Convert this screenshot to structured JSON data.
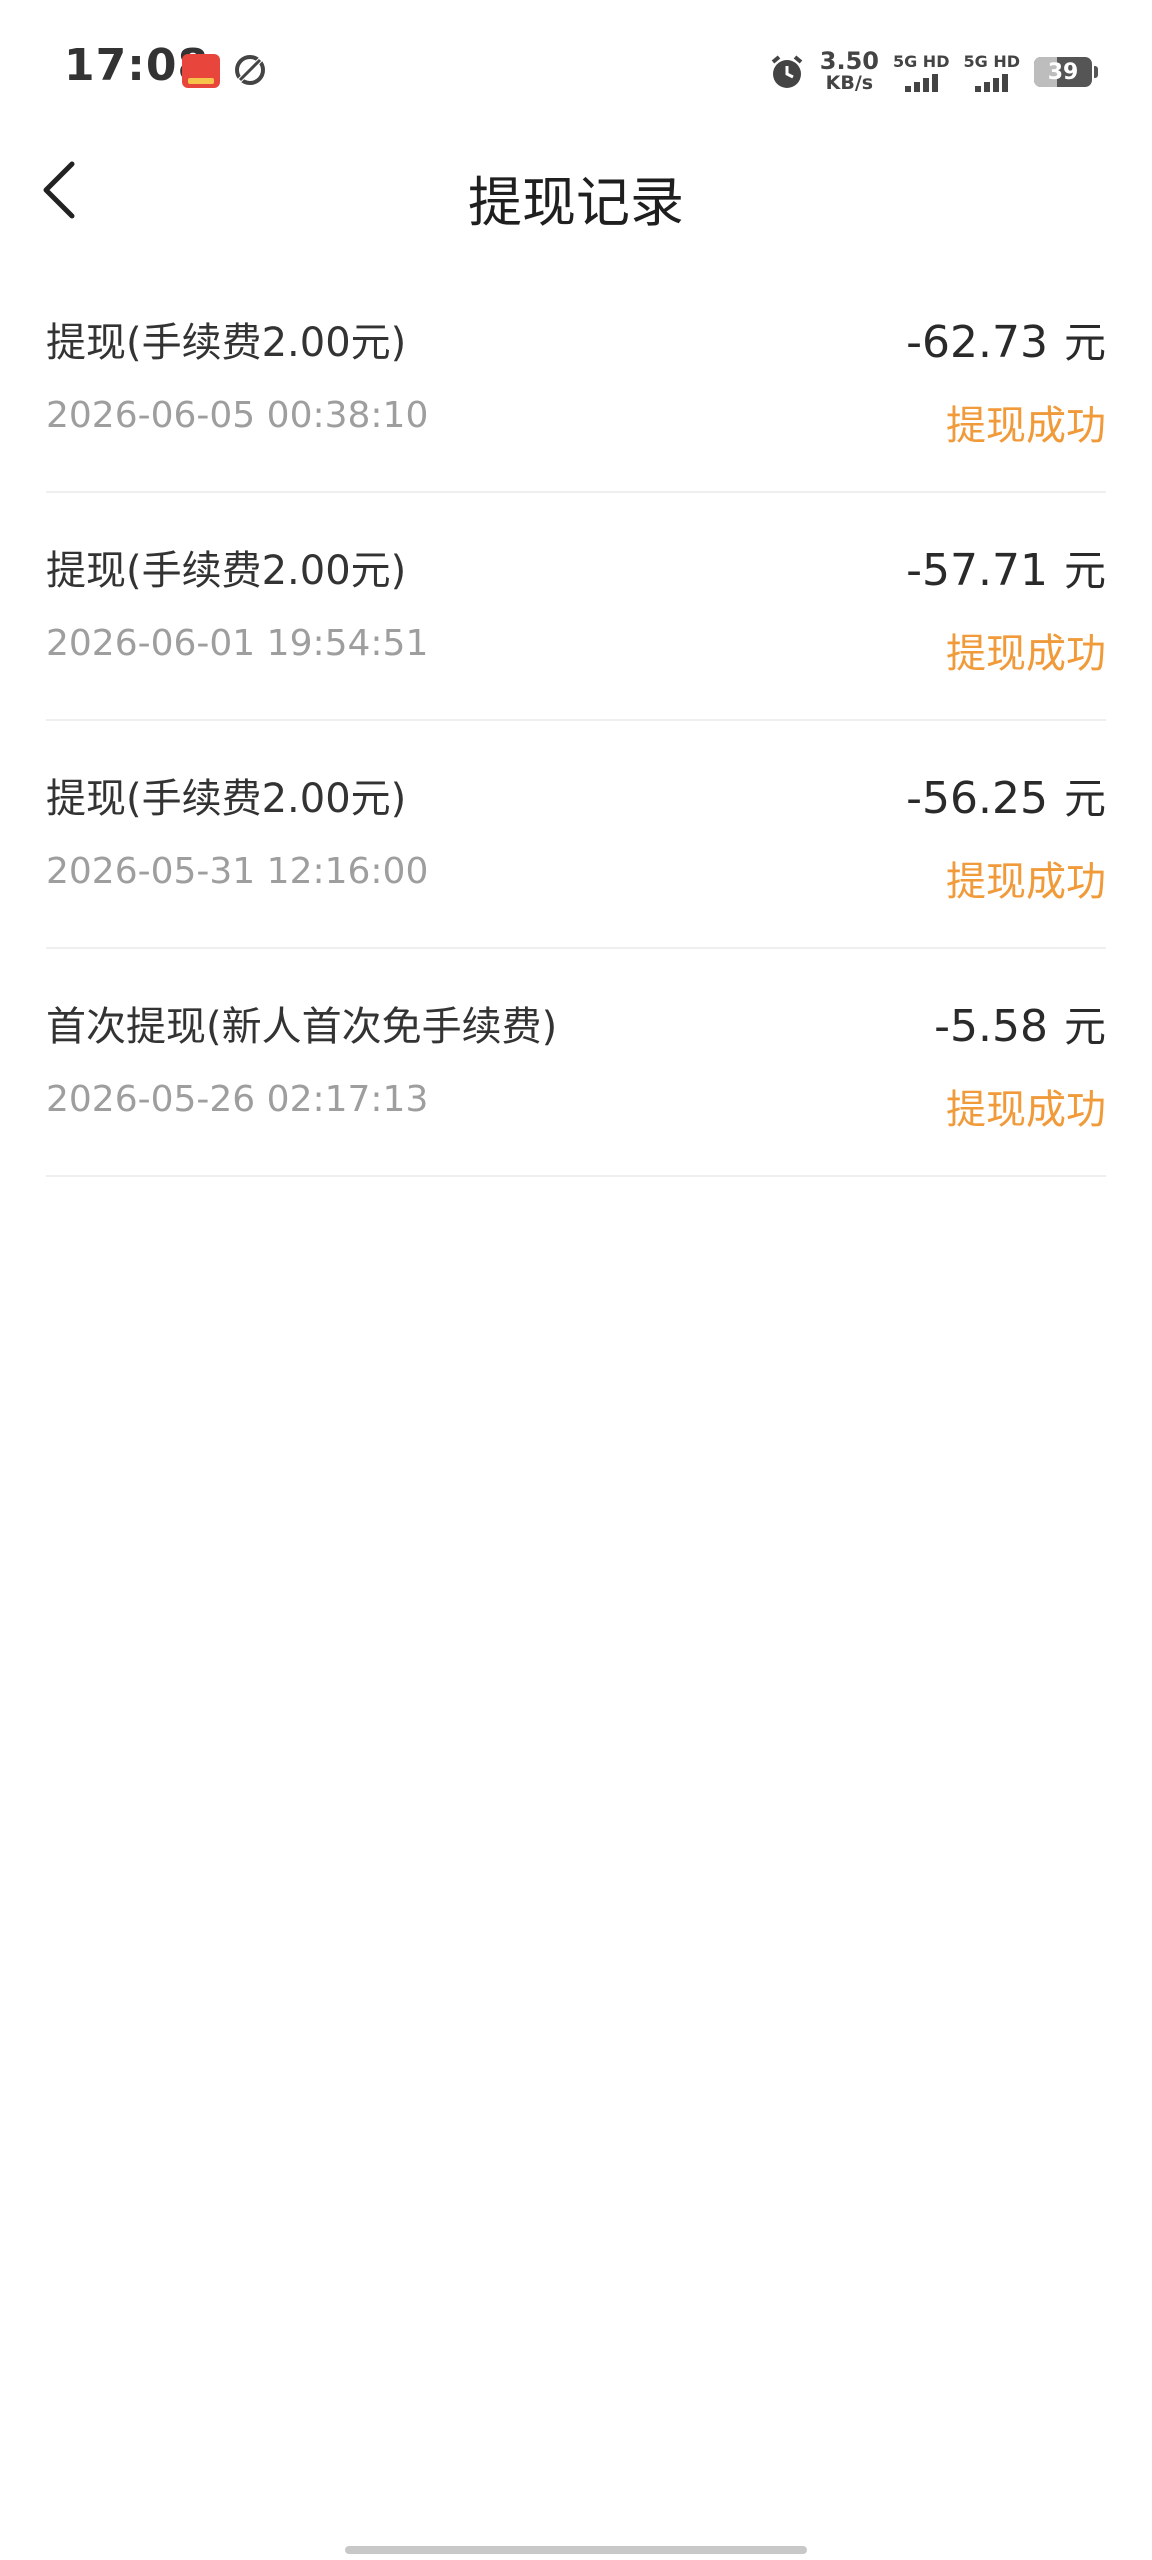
{
  "status_bar": {
    "time": "17:08",
    "net_speed_value": "3.50",
    "net_speed_unit": "KB/s",
    "signal_1_label": "5G HD",
    "signal_2_label": "5G HD",
    "battery_level": "39",
    "battery_percent": 39
  },
  "header": {
    "title": "提现记录"
  },
  "records": [
    {
      "title": "提现(手续费2.00元)",
      "time": "2026-06-05 00:38:10",
      "amount": "-62.73",
      "unit": "元",
      "status": "提现成功"
    },
    {
      "title": "提现(手续费2.00元)",
      "time": "2026-06-01 19:54:51",
      "amount": "-57.71",
      "unit": "元",
      "status": "提现成功"
    },
    {
      "title": "提现(手续费2.00元)",
      "time": "2026-05-31 12:16:00",
      "amount": "-56.25",
      "unit": "元",
      "status": "提现成功"
    },
    {
      "title": "首次提现(新人首次免手续费)",
      "time": "2026-05-26 02:17:13",
      "amount": "-5.58",
      "unit": "元",
      "status": "提现成功"
    }
  ],
  "colors": {
    "status_success": "#f19a3a",
    "secondary_text": "#9e9e9e",
    "primary_text": "#333333"
  },
  "icons": {
    "back": "chevron-left-icon",
    "alarm": "alarm-clock-icon",
    "app_1": "news-app-icon",
    "app_2": "sync-app-icon"
  }
}
